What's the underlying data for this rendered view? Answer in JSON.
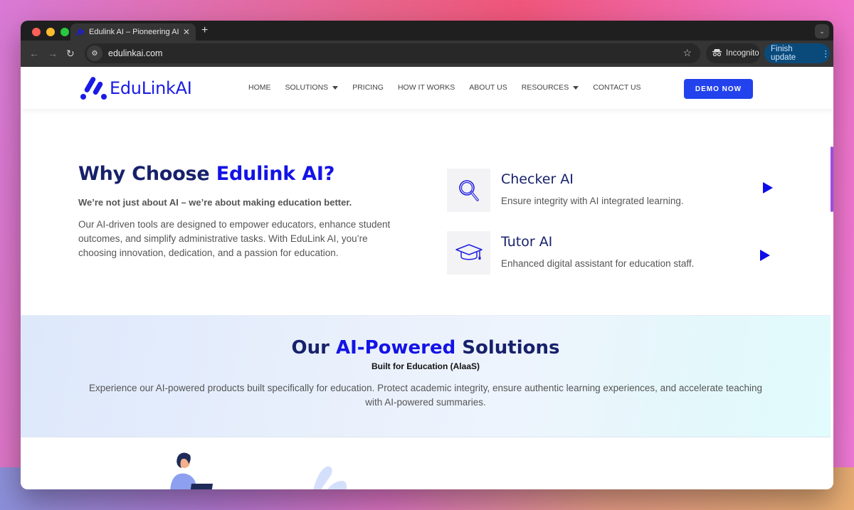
{
  "browser": {
    "tab_title": "Edulink AI – Pioneering AI Sol",
    "url": "edulinkai.com",
    "incognito_label": "Incognito",
    "finish_update_label": "Finish update"
  },
  "header": {
    "logo_text": "EduLinkAI",
    "nav": [
      {
        "label": "HOME",
        "dropdown": false
      },
      {
        "label": "SOLUTIONS",
        "dropdown": true
      },
      {
        "label": "PRICING",
        "dropdown": false
      },
      {
        "label": "HOW IT WORKS",
        "dropdown": false
      },
      {
        "label": "ABOUT US",
        "dropdown": false
      },
      {
        "label": "RESOURCES",
        "dropdown": true
      },
      {
        "label": "CONTACT US",
        "dropdown": false
      }
    ],
    "cta_label": "DEMO NOW"
  },
  "why": {
    "title_prefix": "Why Choose ",
    "title_accent": "Edulink AI?",
    "subtitle": "We’re not just about AI – we’re about making education better.",
    "body": "Our AI-driven tools are designed to empower educators, enhance student outcomes, and simplify administrative tasks. With EduLink AI, you’re choosing innovation, dedication, and a passion for education."
  },
  "features": [
    {
      "title": "Checker AI",
      "description": "Ensure integrity with AI integrated learning.",
      "icon": "magnifier-icon"
    },
    {
      "title": "Tutor AI",
      "description": "Enhanced digital assistant for education staff.",
      "icon": "graduation-cap-icon"
    }
  ],
  "solutions": {
    "title_prefix": "Our ",
    "title_accent": "AI-Powered",
    "title_suffix": " Solutions",
    "subtitle": "Built for Education (AlaaS)",
    "body": "Experience our AI-powered products built specifically for education. Protect academic integrity, ensure authentic learning experiences, and accelerate teaching with AI-powered summaries."
  },
  "colors": {
    "brand": "#1313e6",
    "navy": "#17216b",
    "cta": "#2142ec"
  }
}
